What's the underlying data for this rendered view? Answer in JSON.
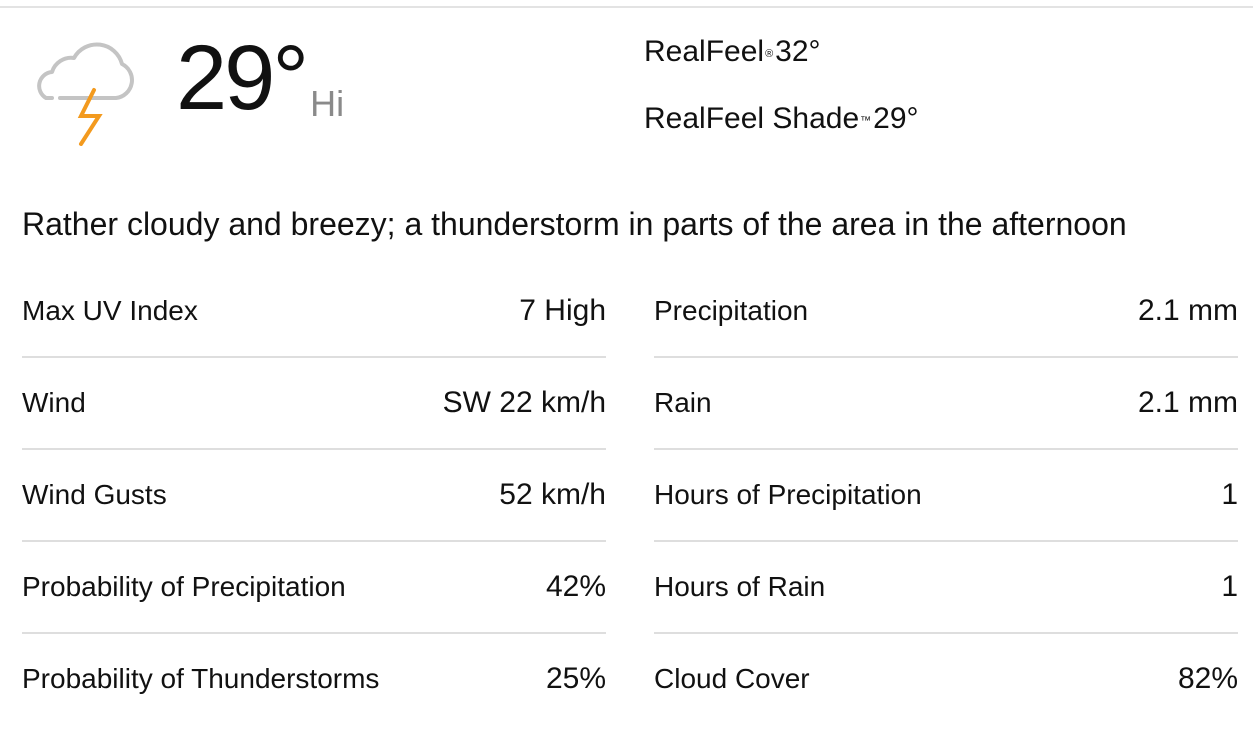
{
  "current": {
    "icon": "thunderstorm-cloud-icon",
    "temperature": "29°",
    "temp_label": "Hi",
    "realfeel_label": "RealFeel",
    "realfeel_mark": "®",
    "realfeel_value": "32°",
    "realfeel_shade_label": "RealFeel Shade",
    "realfeel_shade_mark": "™",
    "realfeel_shade_value": "29°",
    "phrase": "Rather cloudy and breezy; a thunderstorm in parts of the area in the afternoon"
  },
  "colors": {
    "cloud": "#c4c4c4",
    "bolt": "#f39a1e",
    "divider": "#dedede",
    "hi_label": "#8a8a8a"
  },
  "details_left": [
    {
      "label": "Max UV Index",
      "value": "7 High"
    },
    {
      "label": "Wind",
      "value": "SW 22 km/h"
    },
    {
      "label": "Wind Gusts",
      "value": "52 km/h"
    },
    {
      "label": "Probability of Precipitation",
      "value": "42%"
    },
    {
      "label": "Probability of Thunderstorms",
      "value": "25%"
    }
  ],
  "details_right": [
    {
      "label": "Precipitation",
      "value": "2.1 mm"
    },
    {
      "label": "Rain",
      "value": "2.1 mm"
    },
    {
      "label": "Hours of Precipitation",
      "value": "1"
    },
    {
      "label": "Hours of Rain",
      "value": "1"
    },
    {
      "label": "Cloud Cover",
      "value": "82%"
    }
  ]
}
